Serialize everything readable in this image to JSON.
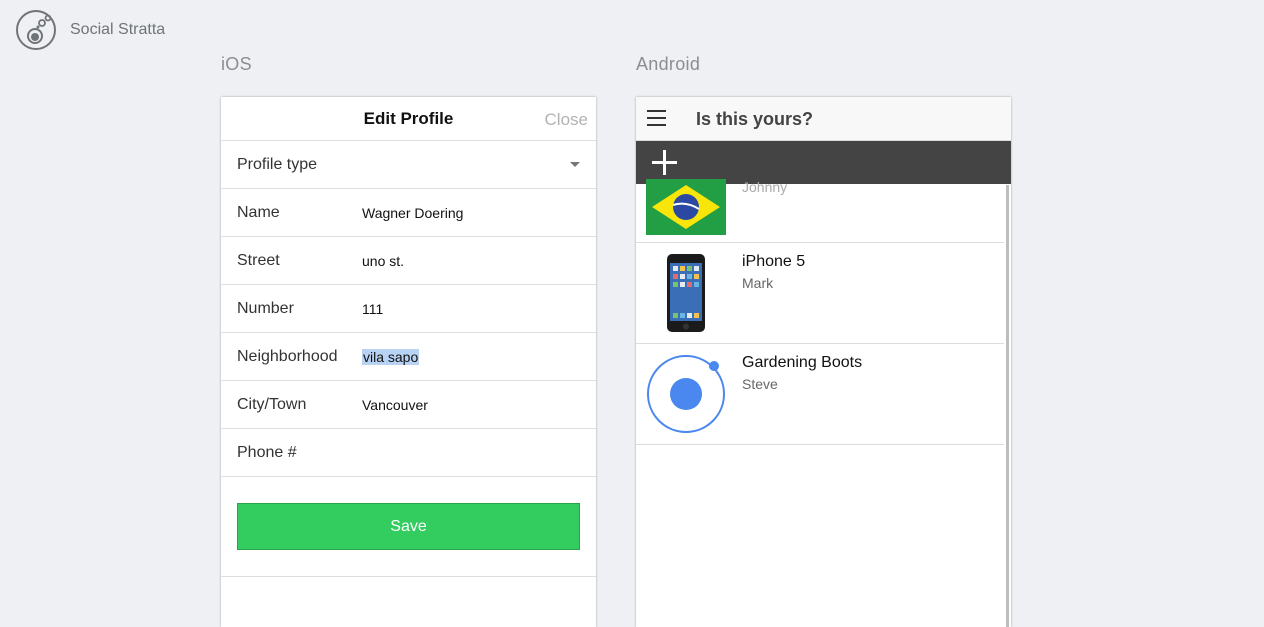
{
  "brand": {
    "name": "Social Stratta",
    "logo_icon": "flask-bubble-logo-icon"
  },
  "ios": {
    "platform_label": "iOS",
    "header": {
      "title": "Edit Profile",
      "close_label": "Close"
    },
    "form": {
      "profile_type": {
        "label": "Profile type",
        "value": ""
      },
      "name": {
        "label": "Name",
        "value": "Wagner Doering"
      },
      "street": {
        "label": "Street",
        "value": "uno st."
      },
      "number": {
        "label": "Number",
        "value": "111"
      },
      "neighborhood": {
        "label": "Neighborhood",
        "value": "vila sapo"
      },
      "city": {
        "label": "City/Town",
        "value": "Vancouver"
      },
      "phone": {
        "label": "Phone #",
        "value": ""
      }
    },
    "save_label": "Save",
    "colors": {
      "save": "#33cd5f",
      "selection": "#b8d2f4"
    }
  },
  "android": {
    "platform_label": "Android",
    "header": {
      "title": "Is this yours?"
    },
    "toolbar": {
      "add_icon": "plus-icon"
    },
    "items": [
      {
        "title": "",
        "subtitle": "Johnny",
        "thumb": "brazil-flag"
      },
      {
        "title": "iPhone 5",
        "subtitle": "Mark",
        "thumb": "iphone-image"
      },
      {
        "title": "Gardening Boots",
        "subtitle": "Steve",
        "thumb": "blue-ring-dot-icon"
      }
    ],
    "colors": {
      "toolbar": "#444444",
      "accent": "#4a87ee"
    }
  }
}
